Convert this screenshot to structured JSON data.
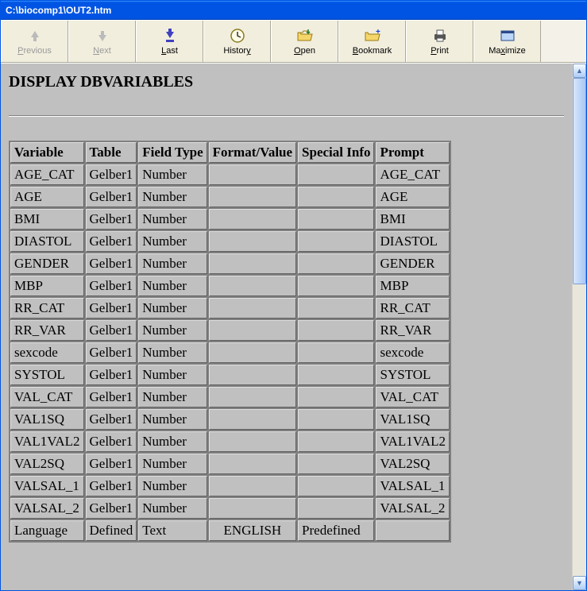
{
  "window": {
    "title": "C:\\biocomp1\\OUT2.htm"
  },
  "toolbar": {
    "previous": "Previous",
    "next": "Next",
    "last": "Last",
    "history": "History",
    "open": "Open",
    "bookmark": "Bookmark",
    "print": "Print",
    "maximize": "Maximize"
  },
  "page": {
    "heading": "DISPLAY DBVARIABLES",
    "table": {
      "headers": [
        "Variable",
        "Table",
        "Field Type",
        "Format/Value",
        "Special Info",
        "Prompt"
      ],
      "rows": [
        {
          "variable": "AGE_CAT",
          "table": "Gelber1",
          "field_type": "Number",
          "format_value": "",
          "special_info": "",
          "prompt": "AGE_CAT"
        },
        {
          "variable": "AGE",
          "table": "Gelber1",
          "field_type": "Number",
          "format_value": "",
          "special_info": "",
          "prompt": "AGE"
        },
        {
          "variable": "BMI",
          "table": "Gelber1",
          "field_type": "Number",
          "format_value": "",
          "special_info": "",
          "prompt": "BMI"
        },
        {
          "variable": "DIASTOL",
          "table": "Gelber1",
          "field_type": "Number",
          "format_value": "",
          "special_info": "",
          "prompt": "DIASTOL"
        },
        {
          "variable": "GENDER",
          "table": "Gelber1",
          "field_type": "Number",
          "format_value": "",
          "special_info": "",
          "prompt": "GENDER"
        },
        {
          "variable": "MBP",
          "table": "Gelber1",
          "field_type": "Number",
          "format_value": "",
          "special_info": "",
          "prompt": "MBP"
        },
        {
          "variable": "RR_CAT",
          "table": "Gelber1",
          "field_type": "Number",
          "format_value": "",
          "special_info": "",
          "prompt": "RR_CAT"
        },
        {
          "variable": "RR_VAR",
          "table": "Gelber1",
          "field_type": "Number",
          "format_value": "",
          "special_info": "",
          "prompt": "RR_VAR"
        },
        {
          "variable": "sexcode",
          "table": "Gelber1",
          "field_type": "Number",
          "format_value": "",
          "special_info": "",
          "prompt": "sexcode"
        },
        {
          "variable": "SYSTOL",
          "table": "Gelber1",
          "field_type": "Number",
          "format_value": "",
          "special_info": "",
          "prompt": "SYSTOL"
        },
        {
          "variable": "VAL_CAT",
          "table": "Gelber1",
          "field_type": "Number",
          "format_value": "",
          "special_info": "",
          "prompt": "VAL_CAT"
        },
        {
          "variable": "VAL1SQ",
          "table": "Gelber1",
          "field_type": "Number",
          "format_value": "",
          "special_info": "",
          "prompt": "VAL1SQ"
        },
        {
          "variable": "VAL1VAL2",
          "table": "Gelber1",
          "field_type": "Number",
          "format_value": "",
          "special_info": "",
          "prompt": "VAL1VAL2"
        },
        {
          "variable": "VAL2SQ",
          "table": "Gelber1",
          "field_type": "Number",
          "format_value": "",
          "special_info": "",
          "prompt": "VAL2SQ"
        },
        {
          "variable": "VALSAL_1",
          "table": "Gelber1",
          "field_type": "Number",
          "format_value": "",
          "special_info": "",
          "prompt": "VALSAL_1"
        },
        {
          "variable": "VALSAL_2",
          "table": "Gelber1",
          "field_type": "Number",
          "format_value": "",
          "special_info": "",
          "prompt": "VALSAL_2"
        },
        {
          "variable": "Language",
          "table": "Defined",
          "field_type": "Text",
          "format_value": "ENGLISH",
          "special_info": "Predefined",
          "prompt": ""
        }
      ]
    }
  }
}
